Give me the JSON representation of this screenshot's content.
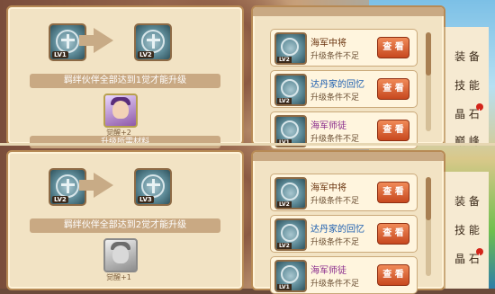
{
  "colors": {
    "parchment": "#f2e3c4",
    "band": "#c9a983",
    "button": "#e0612f",
    "name_brown": "#6b3510",
    "name_blue": "#1d5fb0",
    "name_purple": "#8a2b8c"
  },
  "screens": [
    {
      "evolution": {
        "from_level": "LV1",
        "to_level": "LV2"
      },
      "requirement_text": "羁绊伙伴全部达到1觉才能升级",
      "material": {
        "icon": "purple-hat-portrait",
        "label": "觉醒+2"
      },
      "materials_header": "升级所需材料",
      "cards": [
        {
          "level": "LV2",
          "name": "海军中将",
          "condition": "升级条件不足",
          "button": "查 看",
          "name_color": "brown"
        },
        {
          "level": "LV2",
          "name": "达丹家的回忆",
          "condition": "升级条件不足",
          "button": "查 看",
          "name_color": "blue"
        },
        {
          "level": "LV1",
          "name": "海军师徒",
          "condition": "升级条件不足",
          "button": "查 看",
          "name_color": "purple"
        }
      ],
      "tabs": [
        "装 备",
        "技 能",
        "晶 石",
        "巅 峰"
      ]
    },
    {
      "evolution": {
        "from_level": "LV2",
        "to_level": "LV3"
      },
      "requirement_text": "羁绊伙伴全部达到2觉才能升级",
      "material": {
        "icon": "grey-portrait",
        "label": "觉醒+1"
      },
      "materials_header": "",
      "cards": [
        {
          "level": "LV2",
          "name": "海军中将",
          "condition": "升级条件不足",
          "button": "查 看",
          "name_color": "brown"
        },
        {
          "level": "LV2",
          "name": "达丹家的回忆",
          "condition": "升级条件不足",
          "button": "查 看",
          "name_color": "blue"
        },
        {
          "level": "LV1",
          "name": "海军师徒",
          "condition": "升级条件不足",
          "button": "查 看",
          "name_color": "purple"
        }
      ],
      "tabs": [
        "装 备",
        "技 能",
        "晶 石",
        ""
      ]
    }
  ]
}
